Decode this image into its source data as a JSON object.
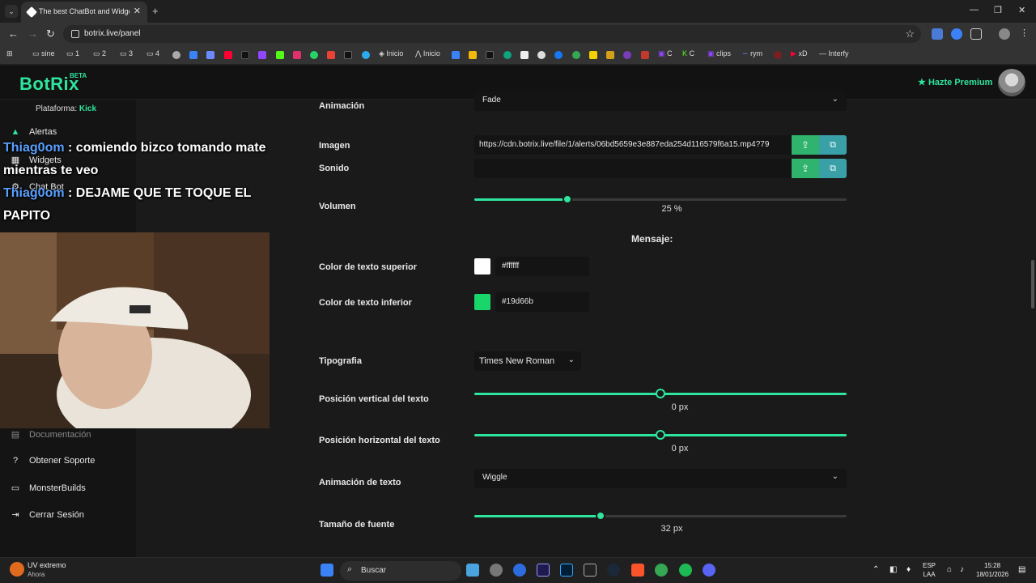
{
  "browser": {
    "tab_title": "The best ChatBot and Widgets",
    "tab_close": "✕",
    "new_tab": "+",
    "url": "botrix.live/panel",
    "bookmarks": [
      "sine",
      "1",
      "2",
      "3",
      "4",
      "Inicio",
      "Inicio",
      "C",
      "C",
      "clips",
      "rym",
      "xD",
      "Interfy"
    ]
  },
  "app": {
    "logo": "BotRix",
    "beta": "BETA",
    "premium": "Hazte Premium",
    "platform_label": "Plataforma:",
    "platform_value": "Kick"
  },
  "sidebar": {
    "items": [
      {
        "label": "Alertas",
        "icon": "warning-icon"
      },
      {
        "label": "Widgets",
        "icon": "grid-icon"
      },
      {
        "label": "Chat Bot",
        "icon": "robot-icon"
      },
      {
        "label": "Documentación",
        "icon": "doc-icon"
      },
      {
        "label": "Obtener Soporte",
        "icon": "help-icon"
      },
      {
        "label": "MonsterBuilds",
        "icon": "laptop-icon"
      },
      {
        "label": "Cerrar Sesión",
        "icon": "logout-icon"
      }
    ]
  },
  "chat": [
    {
      "user": "Thiag0om",
      "text": ": comiendo bizco tomando mate mientras te veo"
    },
    {
      "user": "Thiag0om",
      "text": ": DEJAME QUE TE TOQUE EL PAPITO"
    }
  ],
  "form": {
    "animation_label": "Animación",
    "animation_value": "Fade",
    "image_label": "Imagen",
    "image_value": "https://cdn.botrix.live/file/1/alerts/06bd5659e3e887eda254d116579f6a15.mp4?79",
    "sound_label": "Sonido",
    "sound_value": "",
    "volume_label": "Volumen",
    "volume_value": "25",
    "volume_unit": "%",
    "volume_fraction": 0.25,
    "message_title": "Mensaje:",
    "top_color_label": "Color de texto superior",
    "top_color_value": "#ffffff",
    "bottom_color_label": "Color de texto inferior",
    "bottom_color_value": "#19d66b",
    "typography_label": "Tipografia",
    "typography_value": "Times New Roman",
    "vpos_label": "Posición vertical del texto",
    "vpos_value": "0",
    "vpos_unit": "px",
    "hpos_label": "Posición horizontal del texto",
    "hpos_value": "0",
    "hpos_unit": "px",
    "text_anim_label": "Animación de texto",
    "text_anim_value": "Wiggle",
    "font_size_label": "Tamaño de fuente",
    "font_size_value": "32",
    "font_size_unit": "px"
  },
  "taskbar": {
    "weather_title": "UV extremo",
    "weather_sub": "Ahora",
    "search_placeholder": "Buscar",
    "lang1": "ESP",
    "lang2": "LAA",
    "time": "15:28",
    "date": "18/01/2026"
  },
  "colors": {
    "accent": "#2ee59d",
    "swatch_top": "#ffffff",
    "swatch_bottom": "#19d66b"
  }
}
